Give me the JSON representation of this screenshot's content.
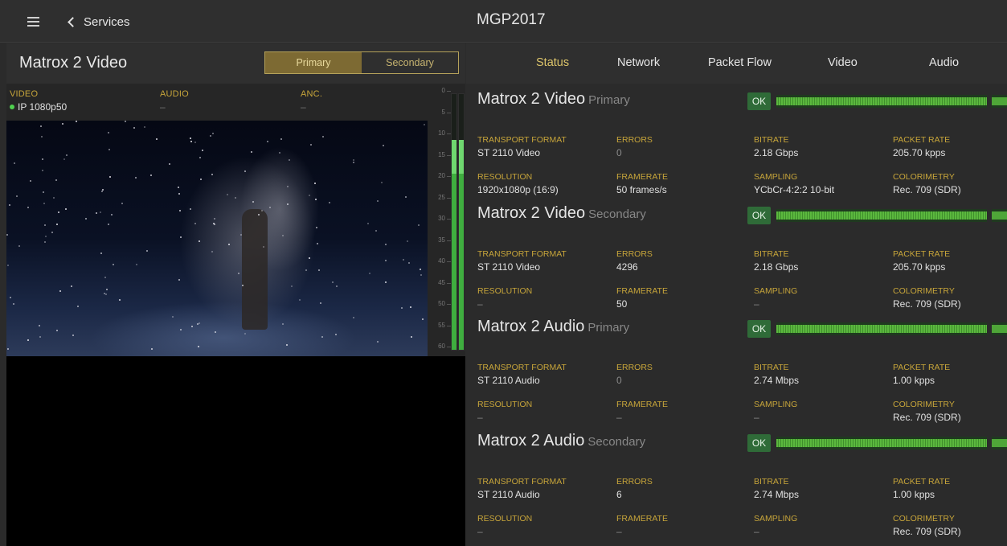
{
  "app": {
    "title": "MGP2017",
    "back_label": "Services"
  },
  "service": {
    "title": "Matrox 2 Video",
    "segments": [
      {
        "label": "Primary",
        "active": true
      },
      {
        "label": "Secondary",
        "active": false
      }
    ]
  },
  "info": {
    "video_label": "VIDEO",
    "video_value": "IP 1080p50",
    "audio_label": "AUDIO",
    "audio_value": "–",
    "anc_label": "ANC.",
    "anc_value": "–"
  },
  "meter": {
    "ticks": [
      "0",
      "5",
      "10",
      "15",
      "20",
      "25",
      "30",
      "35",
      "40",
      "45",
      "50",
      "55",
      "60"
    ],
    "left_level_fraction": 0.82,
    "right_level_fraction": 0.82
  },
  "tabs": [
    {
      "label": "Status",
      "active": true
    },
    {
      "label": "Network",
      "active": false
    },
    {
      "label": "Packet Flow",
      "active": false
    },
    {
      "label": "Video",
      "active": false
    },
    {
      "label": "Audio",
      "active": false
    }
  ],
  "labels": {
    "transport_format": "TRANSPORT FORMAT",
    "errors": "ERRORS",
    "bitrate": "BITRATE",
    "packet_rate": "PACKET RATE",
    "resolution": "RESOLUTION",
    "framerate": "FRAMERATE",
    "sampling": "SAMPLING",
    "colorimetry": "COLORIMETRY"
  },
  "streams": [
    {
      "name": "Matrox 2 Video",
      "sub": "Primary",
      "status": "OK",
      "transport_format": "ST 2110 Video",
      "errors": "0",
      "bitrate": "2.18 Gbps",
      "packet_rate": "205.70 kpps",
      "resolution": "1920x1080p (16:9)",
      "framerate": "50 frames/s",
      "sampling": "YCbCr-4:2:2 10-bit",
      "colorimetry": "Rec. 709 (SDR)"
    },
    {
      "name": "Matrox 2 Video",
      "sub": "Secondary",
      "status": "OK",
      "transport_format": "ST 2110 Video",
      "errors": "4296",
      "bitrate": "2.18 Gbps",
      "packet_rate": "205.70 kpps",
      "resolution": "–",
      "framerate": "50",
      "sampling": "–",
      "colorimetry": "Rec. 709 (SDR)"
    },
    {
      "name": "Matrox 2 Audio",
      "sub": "Primary",
      "status": "OK",
      "transport_format": "ST 2110 Audio",
      "errors": "0",
      "bitrate": "2.74 Mbps",
      "packet_rate": "1.00 kpps",
      "resolution": "–",
      "framerate": "–",
      "sampling": "–",
      "colorimetry": "Rec. 709 (SDR)"
    },
    {
      "name": "Matrox 2 Audio",
      "sub": "Secondary",
      "status": "OK",
      "transport_format": "ST 2110 Audio",
      "errors": "6",
      "bitrate": "2.74 Mbps",
      "packet_rate": "1.00 kpps",
      "resolution": "–",
      "framerate": "–",
      "sampling": "–",
      "colorimetry": "Rec. 709 (SDR)"
    }
  ],
  "colors": {
    "accent_gold": "#c7a53a",
    "status_ok": "#2f6b38",
    "meter_green": "#3fae3f"
  },
  "icons": [
    "menu-icon",
    "chevron-left-icon",
    "status-dot-icon"
  ]
}
